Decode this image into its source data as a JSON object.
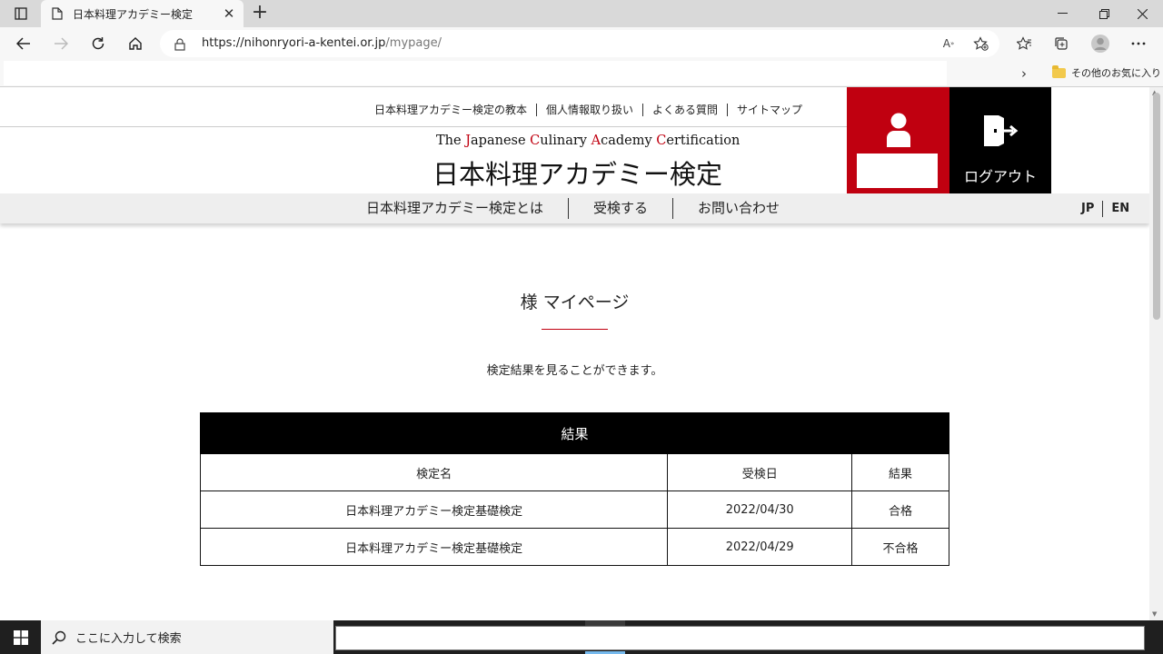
{
  "browser": {
    "tab_title": "日本料理アカデミー検定",
    "url_domain": "https://nihonryori-a-kentei.or.jp",
    "url_path": "/mypage/",
    "favorites_other": "その他のお気に入り"
  },
  "site": {
    "top_links": [
      "日本料理アカデミー検定の教本",
      "個人情報取り扱い",
      "よくある質問",
      "サイトマップ"
    ],
    "brand_en_parts": [
      "The ",
      "J",
      "apanese ",
      "C",
      "ulinary ",
      "A",
      "cademy ",
      "C",
      "ertification"
    ],
    "brand_jp": "日本料理アカデミー検定",
    "logout_label": "ログアウト",
    "main_nav": [
      "日本料理アカデミー検定とは",
      "受検する",
      "お問い合わせ"
    ],
    "lang": [
      "JP",
      "EN"
    ],
    "accent_color": "#c00010"
  },
  "content": {
    "page_title": "様 マイページ",
    "lead": "検定結果を見ることができます。",
    "table": {
      "caption": "結果",
      "headers": [
        "検定名",
        "受検日",
        "結果"
      ],
      "rows": [
        [
          "日本料理アカデミー検定基礎検定",
          "2022/04/30",
          "合格"
        ],
        [
          "日本料理アカデミー検定基礎検定",
          "2022/04/29",
          "不合格"
        ]
      ]
    }
  },
  "taskbar": {
    "search_placeholder": "ここに入力して検索"
  }
}
